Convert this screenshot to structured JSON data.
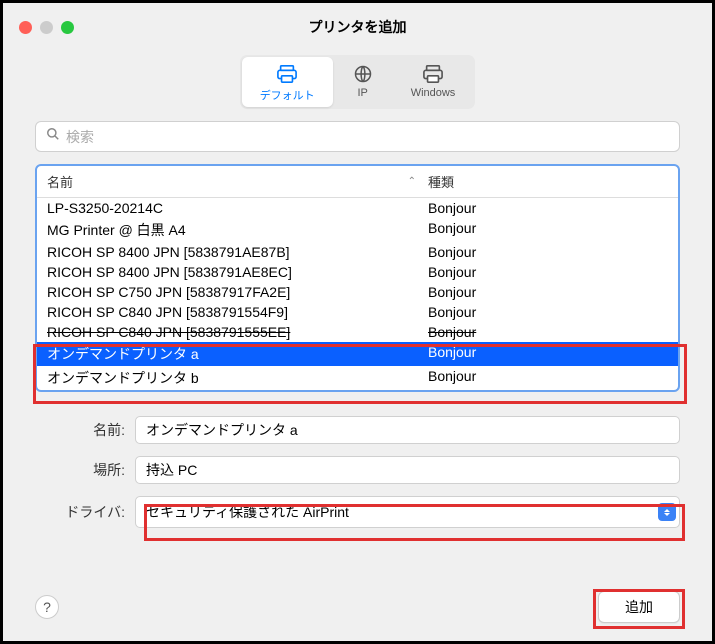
{
  "window": {
    "title": "プリンタを追加"
  },
  "toolbar": {
    "items": [
      {
        "label": "デフォルト",
        "icon": "printer-icon",
        "active": true
      },
      {
        "label": "IP",
        "icon": "globe-icon",
        "active": false
      },
      {
        "label": "Windows",
        "icon": "windows-printer-icon",
        "active": false
      }
    ]
  },
  "search": {
    "placeholder": "検索"
  },
  "list": {
    "headers": {
      "name": "名前",
      "kind": "種類"
    },
    "rows": [
      {
        "name": "LP-S3250-20214C",
        "kind": "Bonjour",
        "selected": false,
        "strike": false
      },
      {
        "name": "MG Printer @ 白黒 A4",
        "kind": "Bonjour",
        "selected": false,
        "strike": false
      },
      {
        "name": "RICOH SP 8400 JPN [5838791AE87B]",
        "kind": "Bonjour",
        "selected": false,
        "strike": false
      },
      {
        "name": "RICOH SP 8400 JPN [5838791AE8EC]",
        "kind": "Bonjour",
        "selected": false,
        "strike": false
      },
      {
        "name": "RICOH SP C750 JPN [58387917FA2E]",
        "kind": "Bonjour",
        "selected": false,
        "strike": false
      },
      {
        "name": "RICOH SP C840 JPN [5838791554F9]",
        "kind": "Bonjour",
        "selected": false,
        "strike": false
      },
      {
        "name": "RICOH SP C840 JPN [5838791555EE]",
        "kind": "Bonjour",
        "selected": false,
        "strike": true
      },
      {
        "name": "オンデマンドプリンタ a",
        "kind": "Bonjour",
        "selected": true,
        "strike": false
      },
      {
        "name": "オンデマンドプリンタ b",
        "kind": "Bonjour",
        "selected": false,
        "strike": false
      }
    ]
  },
  "form": {
    "name_label": "名前:",
    "name_value": "オンデマンドプリンタ a",
    "location_label": "場所:",
    "location_value": "持込 PC",
    "driver_label": "ドライバ:",
    "driver_value": "セキュリティ保護された AirPrint"
  },
  "footer": {
    "help_label": "?",
    "add_label": "追加"
  }
}
